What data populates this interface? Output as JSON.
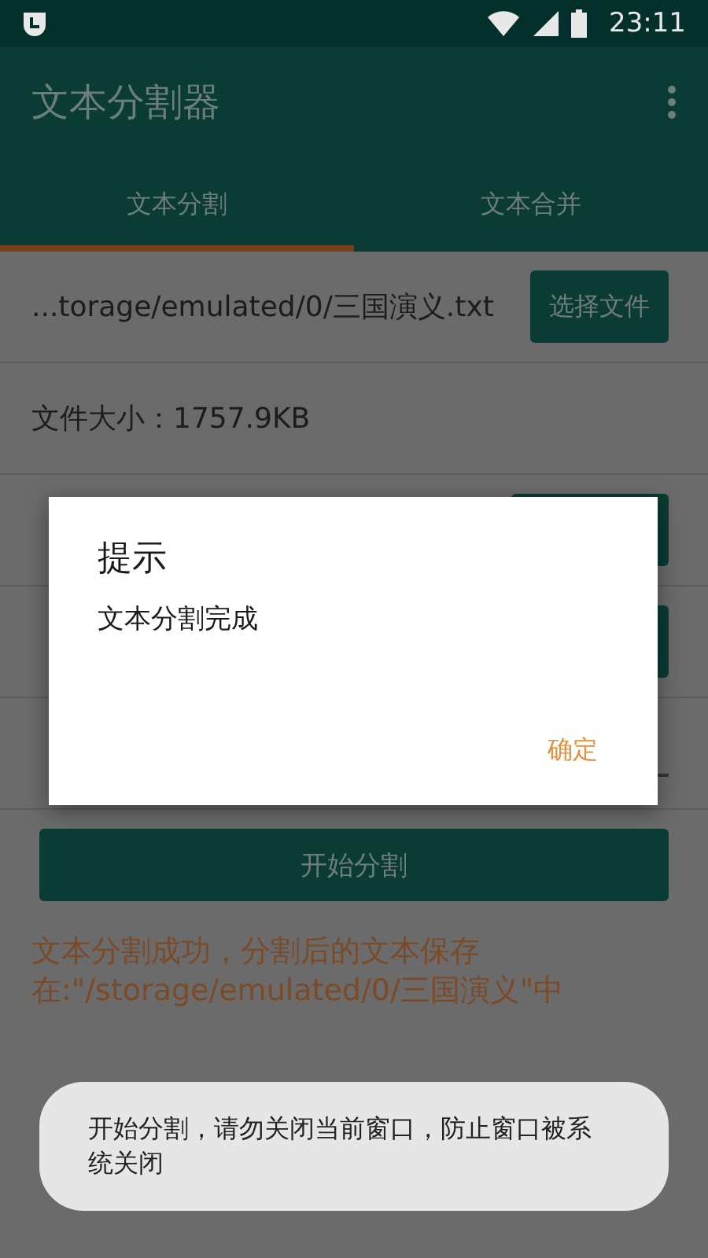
{
  "status_bar": {
    "time": "23:11"
  },
  "app_bar": {
    "title": "文本分割器"
  },
  "tabs": [
    {
      "label": "文本分割",
      "selected": true
    },
    {
      "label": "文本合并",
      "selected": false
    }
  ],
  "file_row": {
    "path": "...torage/emulated/0/三国演义.txt",
    "button": "选择文件"
  },
  "size_row": {
    "label": "文件大小：1757.9KB"
  },
  "partial_rows": [
    {
      "kind": "button"
    },
    {
      "kind": "button"
    },
    {
      "kind": "field"
    }
  ],
  "start_button": "开始分割",
  "result_message": "文本分割成功，分割后的文本保存在:\"/storage/emulated/0/三国演义\"中",
  "dialog": {
    "title": "提示",
    "message": "文本分割完成",
    "button": "确定"
  },
  "toast": {
    "message": "开始分割，请勿关闭当前窗口，防止窗口被系统关闭"
  }
}
